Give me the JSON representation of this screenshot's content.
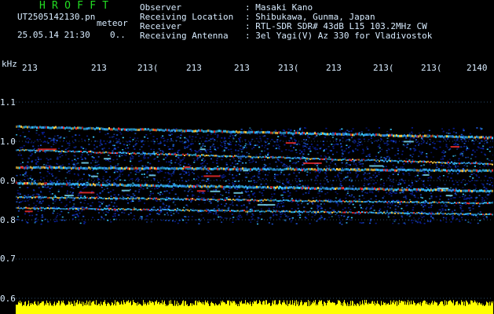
{
  "header": {
    "title": "H R O F F T",
    "filename": "UT2505142130.pn",
    "mode": "meteor",
    "datetime": "25.05.14 21:30",
    "counter": "0..",
    "info": [
      {
        "label": "Observer",
        "value": ": Masaki Kano"
      },
      {
        "label": "Receiving Location",
        "value": ": Shibukawa, Gunma, Japan"
      },
      {
        "label": "Receiver",
        "value": ": RTL-SDR SDR# 43dB L15 103.2MHz CW"
      },
      {
        "label": "Receiving Antenna",
        "value": ": 3el Yagi(V) Az 330 for Vladivostok"
      }
    ]
  },
  "axis": {
    "unit": "kHz",
    "x_ticks": [
      "213",
      "213",
      "213(",
      "213",
      "213",
      "213(",
      "213",
      "213(",
      "213(",
      "2140"
    ],
    "y_ticks": [
      "1.1",
      "1.0",
      "0.9",
      "0.8",
      "0.7",
      "0.6"
    ]
  },
  "colors": {
    "background": "#000000",
    "text": "#d8ecff",
    "title": "#22dd22",
    "signal_low": "#0a1f9a",
    "signal_mid": "#38c8ff",
    "signal_high": "#ff3030",
    "power_trace": "#ffff00"
  }
}
